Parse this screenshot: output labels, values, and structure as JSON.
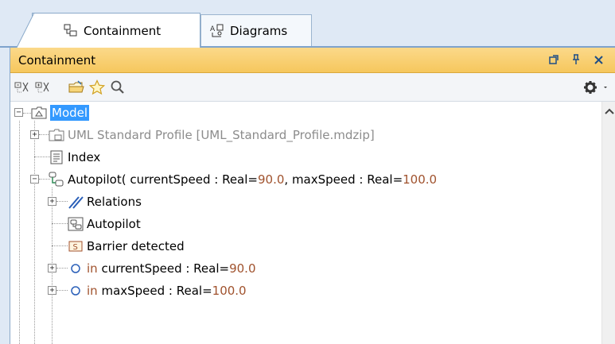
{
  "tabs": [
    {
      "label": "Containment",
      "icon": "containment-tab-icon",
      "active": true
    },
    {
      "label": "Diagrams",
      "icon": "diagrams-tab-icon",
      "active": false
    }
  ],
  "panel": {
    "title": "Containment",
    "title_actions": [
      "pin-icon",
      "float-icon",
      "close-icon"
    ]
  },
  "toolbar": {
    "left_buttons": [
      "collapse-all-icon",
      "expand-all-icon",
      "open-folder-icon",
      "favorite-star-icon",
      "search-icon"
    ],
    "right_button": "settings-gear-icon"
  },
  "tree": {
    "root": {
      "label": "Model",
      "selected": true
    },
    "items": [
      {
        "label": "UML Standard Profile [UML_Standard_Profile.mdzip]",
        "style": "grey"
      },
      {
        "label": "Index"
      },
      {
        "label_prefix": "Autopilot( currentSpeed : Real=",
        "value1": "90.0",
        "label_mid": ", maxSpeed : Real=",
        "value2": "100.0"
      },
      {
        "label": "Relations"
      },
      {
        "label": "Autopilot"
      },
      {
        "label": "Barrier detected"
      },
      {
        "prefix": "in ",
        "label": "currentSpeed : Real=",
        "value": "90.0"
      },
      {
        "prefix": "in ",
        "label": "maxSpeed : Real=",
        "value": "100.0"
      }
    ]
  },
  "colors": {
    "selection": "#3399ff",
    "title_bar": "#f6c75d",
    "value_text": "#a0522d",
    "grey_text": "#8c8c8c"
  }
}
